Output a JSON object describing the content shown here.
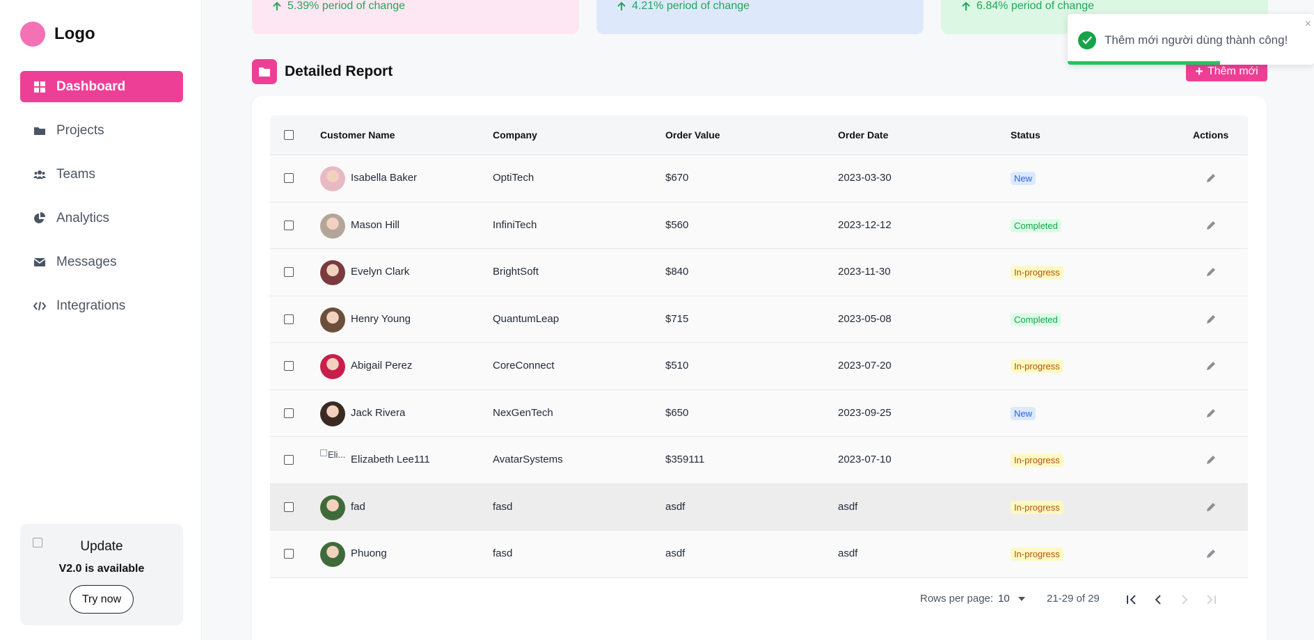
{
  "sidebar": {
    "logo": "Logo",
    "items": [
      {
        "label": "Dashboard",
        "icon": "dashboard-icon",
        "active": true
      },
      {
        "label": "Projects",
        "icon": "folder-icon"
      },
      {
        "label": "Teams",
        "icon": "users-icon"
      },
      {
        "label": "Analytics",
        "icon": "pie-chart-icon"
      },
      {
        "label": "Messages",
        "icon": "envelope-icon"
      },
      {
        "label": "Integrations",
        "icon": "code-icon"
      }
    ],
    "update": {
      "title": "Update",
      "subtitle": "V2.0 is available",
      "button": "Try now"
    }
  },
  "stats": [
    {
      "text": "5.39% period of change",
      "bg": "#fde7f2"
    },
    {
      "text": "4.21% period of change",
      "bg": "#dde9fb"
    },
    {
      "text": "6.84% period of change",
      "bg": "#dcf7e4"
    }
  ],
  "report": {
    "title": "Detailed Report",
    "add_label": "Thêm mới",
    "columns": [
      "Customer Name",
      "Company",
      "Order Value",
      "Order Date",
      "Status",
      "Actions"
    ],
    "rows": [
      {
        "name": "Isabella Baker",
        "company": "OptiTech",
        "value": "$670",
        "date": "2023-03-30",
        "status": "New",
        "avatar": "#e8b9c4"
      },
      {
        "name": "Mason Hill",
        "company": "InfiniTech",
        "value": "$560",
        "date": "2023-12-12",
        "status": "Completed",
        "avatar": "#b4a59a"
      },
      {
        "name": "Evelyn Clark",
        "company": "BrightSoft",
        "value": "$840",
        "date": "2023-11-30",
        "status": "In-progress",
        "avatar": "#7a3b3f"
      },
      {
        "name": "Henry Young",
        "company": "QuantumLeap",
        "value": "$715",
        "date": "2023-05-08",
        "status": "Completed",
        "avatar": "#6b4f3a"
      },
      {
        "name": "Abigail Perez",
        "company": "CoreConnect",
        "value": "$510",
        "date": "2023-07-20",
        "status": "In-progress",
        "avatar": "#c81e4c"
      },
      {
        "name": "Jack Rivera",
        "company": "NexGenTech",
        "value": "$650",
        "date": "2023-09-25",
        "status": "New",
        "avatar": "#3b2a22"
      },
      {
        "name": "Elizabeth Lee111",
        "company": "AvatarSystems",
        "value": "$359111",
        "date": "2023-07-10",
        "status": "In-progress",
        "avatar_broken_alt": "Eli..."
      },
      {
        "name": "fad",
        "company": "fasd",
        "value": "asdf",
        "date": "asdf",
        "status": "In-progress",
        "avatar": "#3f6b3a",
        "highlight": true
      },
      {
        "name": "Phuong",
        "company": "fasd",
        "value": "asdf",
        "date": "asdf",
        "status": "In-progress",
        "avatar": "#3f6b3a"
      }
    ],
    "pagination": {
      "rows_label": "Rows per page:",
      "rows_value": "10",
      "range": "21-29 of 29"
    }
  },
  "toast": {
    "message": "Thêm mới người dùng thành công!",
    "close": "×",
    "progress": 0.62
  }
}
